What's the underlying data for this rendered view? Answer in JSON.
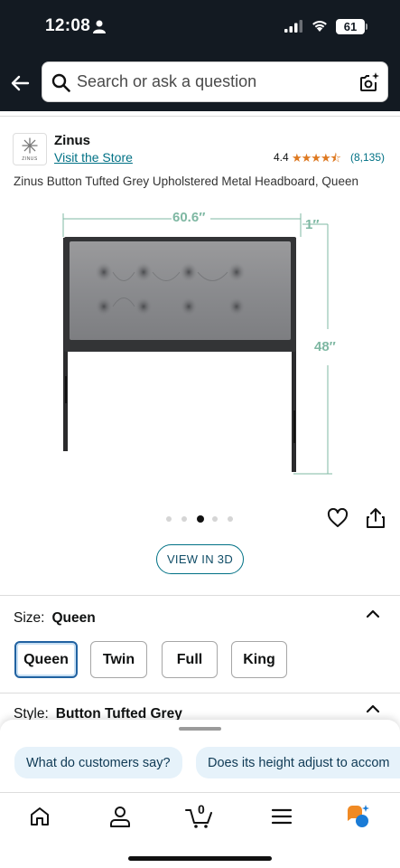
{
  "status_bar": {
    "time": "12:08",
    "battery": "61"
  },
  "search": {
    "placeholder": "Search or ask a question"
  },
  "product": {
    "brand": "Zinus",
    "brand_logo_text": "ZINUS",
    "store_link": "Visit the Store",
    "rating": "4.4",
    "stars": "★★★★⯪",
    "review_count": "(8,135)",
    "title": "Zinus Button Tufted Grey Upholstered Metal Headboard, Queen",
    "dimensions": {
      "width": "60.6″",
      "depth": "1″",
      "height": "48″"
    },
    "image_dots": 5,
    "active_dot": 3
  },
  "view3d": {
    "label": "VIEW IN 3D"
  },
  "size": {
    "label": "Size:",
    "value": "Queen",
    "options": [
      "Queen",
      "Twin",
      "Full",
      "King"
    ],
    "selected": "Queen"
  },
  "style": {
    "label": "Style:",
    "value": "Button Tufted Grey"
  },
  "questions": {
    "chips": [
      "What do customers say?",
      "Does its height adjust to accom"
    ]
  },
  "nav": {
    "cart_count": "0"
  },
  "colors": {
    "header_bg": "#131a22",
    "link": "#007185",
    "star": "#de7921",
    "selected_border": "#2162a1",
    "dimension_green": "#7fb8a3",
    "chip_bg": "#e6f2fa"
  }
}
